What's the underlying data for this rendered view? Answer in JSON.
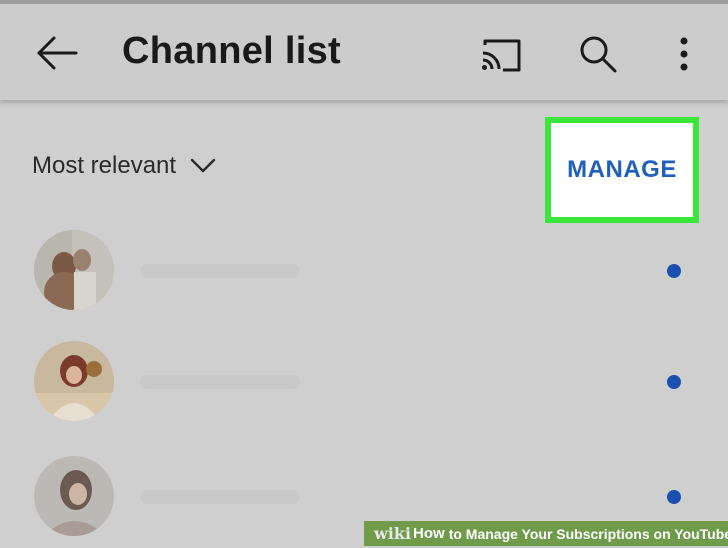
{
  "app_bar": {
    "title": "Channel list",
    "back_icon": "arrow-left-icon",
    "cast_icon": "cast-icon",
    "search_icon": "search-icon",
    "more_icon": "more-vert-icon"
  },
  "toolbar": {
    "sort_label": "Most relevant",
    "sort_icon": "chevron-down-icon",
    "manage_label": "MANAGE"
  },
  "channels": [
    {
      "avatar": "avatar-1",
      "has_new_content": true
    },
    {
      "avatar": "avatar-2",
      "has_new_content": true
    },
    {
      "avatar": "avatar-3",
      "has_new_content": true
    }
  ],
  "colors": {
    "accent": "#1e5fc0",
    "highlight_border": "#39e639",
    "dot": "#1b4fb0",
    "watermark_bg": "#6f9b4b"
  },
  "watermark": {
    "wiki": "wiki",
    "how": "How",
    "rest": "to Manage Your Subscriptions on YouTube"
  }
}
